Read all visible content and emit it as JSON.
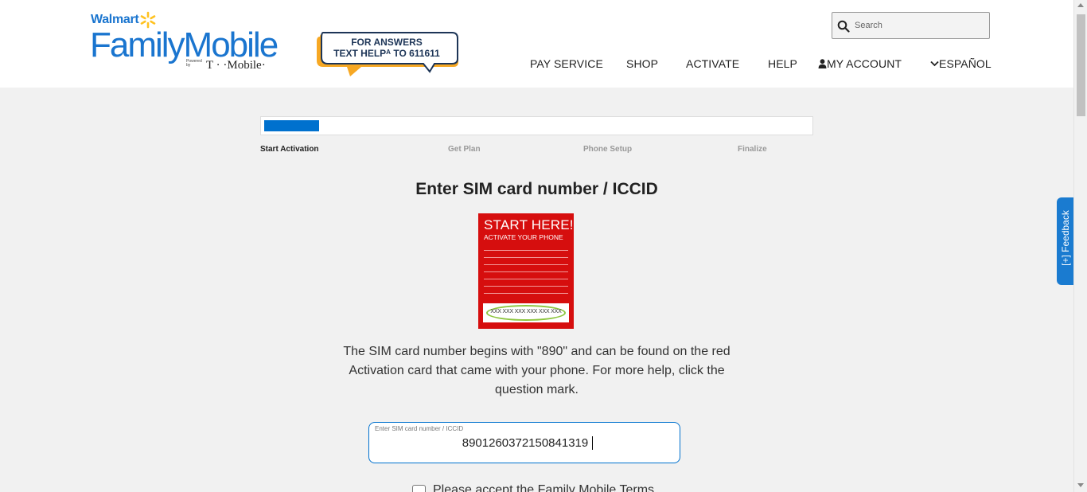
{
  "header": {
    "logo": {
      "brand_small": "Walmart",
      "brand_main": "FamilyMobile",
      "powered_by": "Powered by",
      "partner": "T · ·Mobile·"
    },
    "promo": {
      "line1": "FOR ANSWERS",
      "line2": "TEXT HELPᴬ TO 611611"
    },
    "search": {
      "placeholder": "Search"
    },
    "nav": {
      "pay_service": "PAY SERVICE",
      "shop": "SHOP",
      "activate": "ACTIVATE",
      "help": "HELP",
      "my_account": "MY ACCOUNT",
      "espanol": "ESPAÑOL"
    }
  },
  "progress": {
    "fraction": 0.1,
    "steps": [
      "Start Activation",
      "Get Plan",
      "Phone Setup",
      "Finalize"
    ],
    "active_step": 0
  },
  "main": {
    "title": "Enter SIM card number / ICCID",
    "sim_card": {
      "headline": "START HERE!",
      "subline": "ACTIVATE YOUR PHONE",
      "number_mask": "XXX XXX XXX XXX XXX XXX"
    },
    "description": "The SIM card number begins with \"890\" and can be found on the red Activation card that came with your phone. For more help, click the question mark.",
    "sim_field": {
      "label": "Enter SIM card number / ICCID",
      "value": "8901260372150841319"
    },
    "terms_label": "Please accept the Family Mobile Terms"
  },
  "feedback": {
    "label": "Feedback"
  },
  "colors": {
    "brand_blue": "#1a75cf",
    "progress_blue": "#0071ce",
    "sim_red": "#d60e0e",
    "highlight_green": "#8dc63f"
  }
}
